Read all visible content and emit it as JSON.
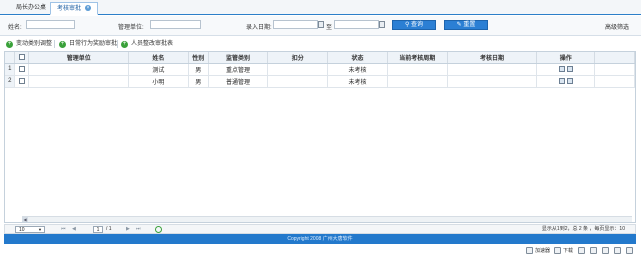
{
  "tabs": [
    {
      "label": "局长办公桌"
    },
    {
      "label": "考核审批",
      "close": "×"
    }
  ],
  "search": {
    "name_label": "姓名:",
    "unit_label": "管理单位:",
    "date_label": "录入日期:",
    "date_sep": "至",
    "query_label": "查询",
    "reset_label": "重置",
    "advanced_label": "高级筛选"
  },
  "toolbar": {
    "plus": "+",
    "items": [
      "变动类别调整",
      "日常行为奖励审批",
      "人员整改审批表"
    ]
  },
  "grid": {
    "columns": [
      "管理单位",
      "姓名",
      "性别",
      "监管类别",
      "扣分",
      "状态",
      "当前考核周期",
      "考核日期",
      "操作"
    ],
    "rows": [
      {
        "index": "1",
        "unit": "",
        "name": "测试",
        "gender": "男",
        "category": "重点管理",
        "score": "",
        "status": "未考核",
        "period": "",
        "date": ""
      },
      {
        "index": "2",
        "unit": "",
        "name": "小明",
        "gender": "男",
        "category": "普通管理",
        "score": "",
        "status": "未考核",
        "period": "",
        "date": ""
      }
    ]
  },
  "pager": {
    "page_size": "10",
    "page_number": "1",
    "page_total": "/ 1",
    "info": "显示从1到2，总 2 条 ，每页显示：10"
  },
  "footer": {
    "copyright": "Copyright 2008 广州大唐软件"
  },
  "statusbar": {
    "accelerator": "加速器",
    "download": "下载"
  }
}
